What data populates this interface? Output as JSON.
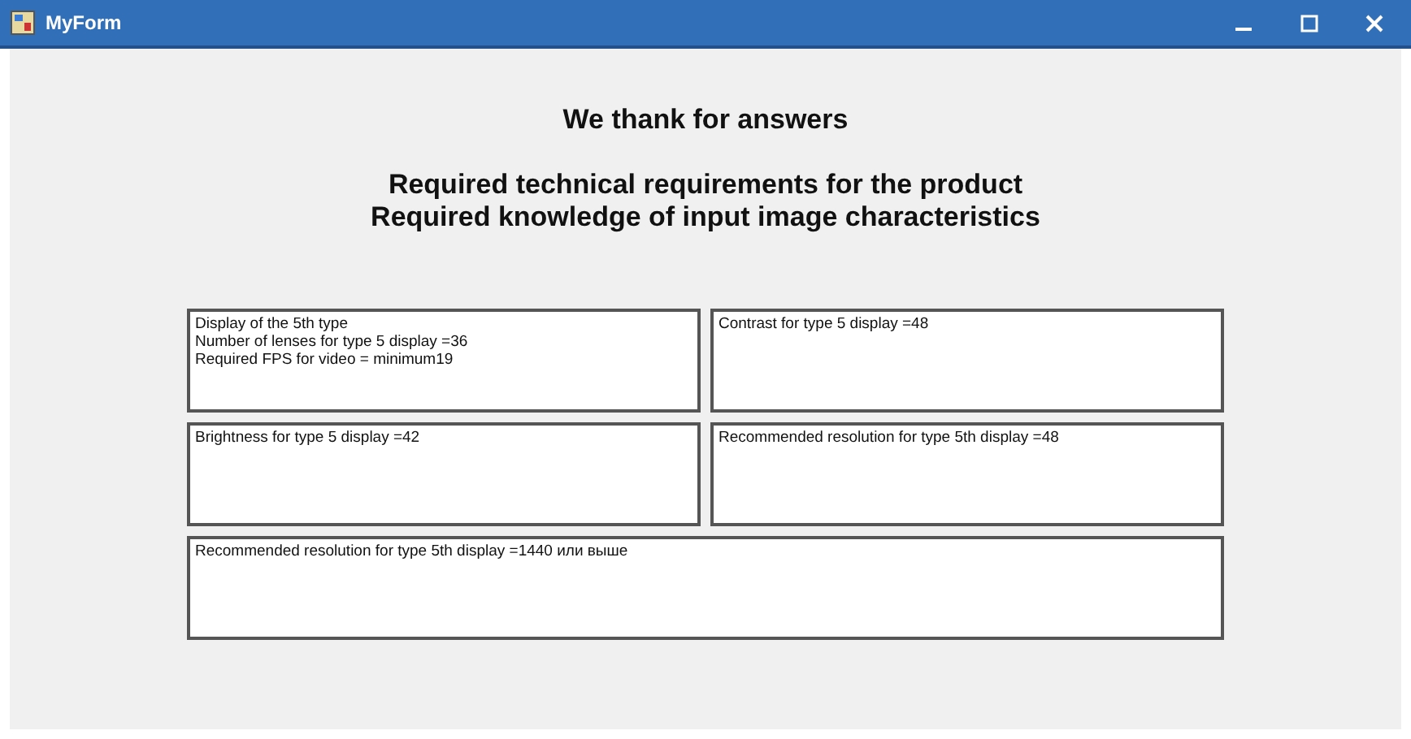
{
  "window": {
    "title": "MyForm"
  },
  "headings": [
    "We thank for answers",
    "Required technical requirements for the product",
    "Required knowledge of input image characteristics"
  ],
  "boxes": [
    {
      "lines": [
        "Display of the 5th type",
        "Number of lenses for type 5 display =36",
        "Required FPS for video = minimum19"
      ]
    },
    {
      "lines": [
        "Contrast for type 5 display =48"
      ]
    },
    {
      "lines": [
        "Brightness for type 5 display =42"
      ]
    },
    {
      "lines": [
        "Recommended resolution for type 5th display =48"
      ]
    },
    {
      "lines": [
        "Recommended resolution for type 5th display =1440 или выше"
      ],
      "wide": true
    }
  ]
}
